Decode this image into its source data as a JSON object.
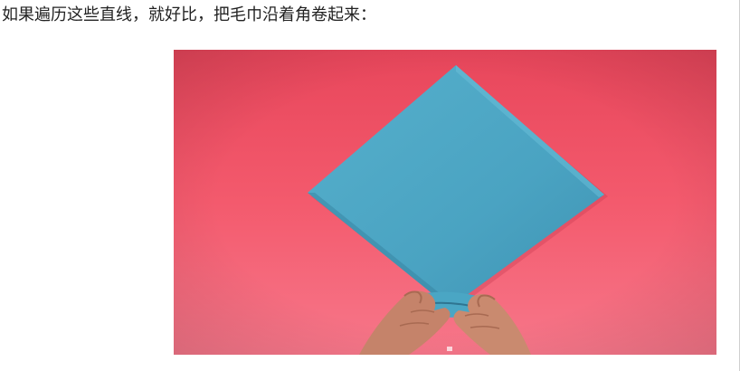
{
  "caption": "如果遍历这些直线，就好比，把毛巾沿着角卷起来：",
  "image": {
    "alt": "",
    "colors": {
      "background_top": "#e9495d",
      "background_bottom": "#f56c7d",
      "towel": "#4fa8c5",
      "towel_shadow": "#3d8fae",
      "skin": "#c7876a"
    }
  }
}
